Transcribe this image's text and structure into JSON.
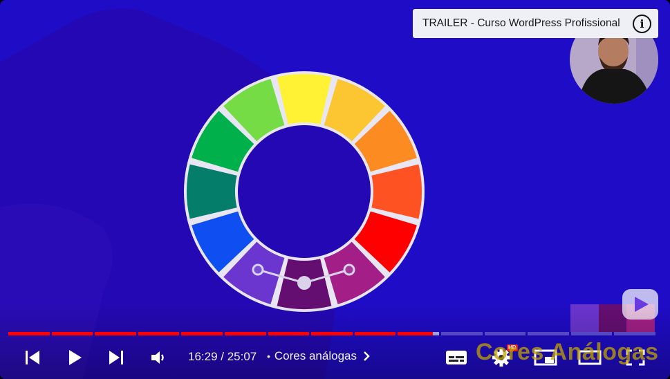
{
  "card": {
    "title": "TRAILER - Curso WordPress Profissional"
  },
  "controls": {
    "time": "16:29 / 25:07",
    "chapter": "Cores análogas",
    "hd_badge": "HD"
  },
  "watermark": {
    "text": "Cores Análogas"
  },
  "playback": {
    "played_fraction": 0.656
  },
  "icons": [
    "skip-previous-icon",
    "play-icon",
    "skip-next-icon",
    "volume-icon",
    "chevron-right-icon",
    "subtitles-icon",
    "settings-icon",
    "miniplayer-icon",
    "theater-mode-icon",
    "fullscreen-icon",
    "info-icon",
    "channel-watermark-logo-icon"
  ],
  "colors": {
    "background": "#1F0CC7",
    "progress_played": "#FF0000",
    "progress_buffered": "rgba(255,255,255,0.6)",
    "progress_unplayed": "rgba(255,255,255,0.25)",
    "wheel_segments": [
      "#FFF133",
      "#FCC632",
      "#FC8B22",
      "#FE5222",
      "#FE0000",
      "#A31F87",
      "#650E72",
      "#6B35D0",
      "#0F4EF0",
      "#047E6B",
      "#00B04B",
      "#76DC46"
    ]
  }
}
